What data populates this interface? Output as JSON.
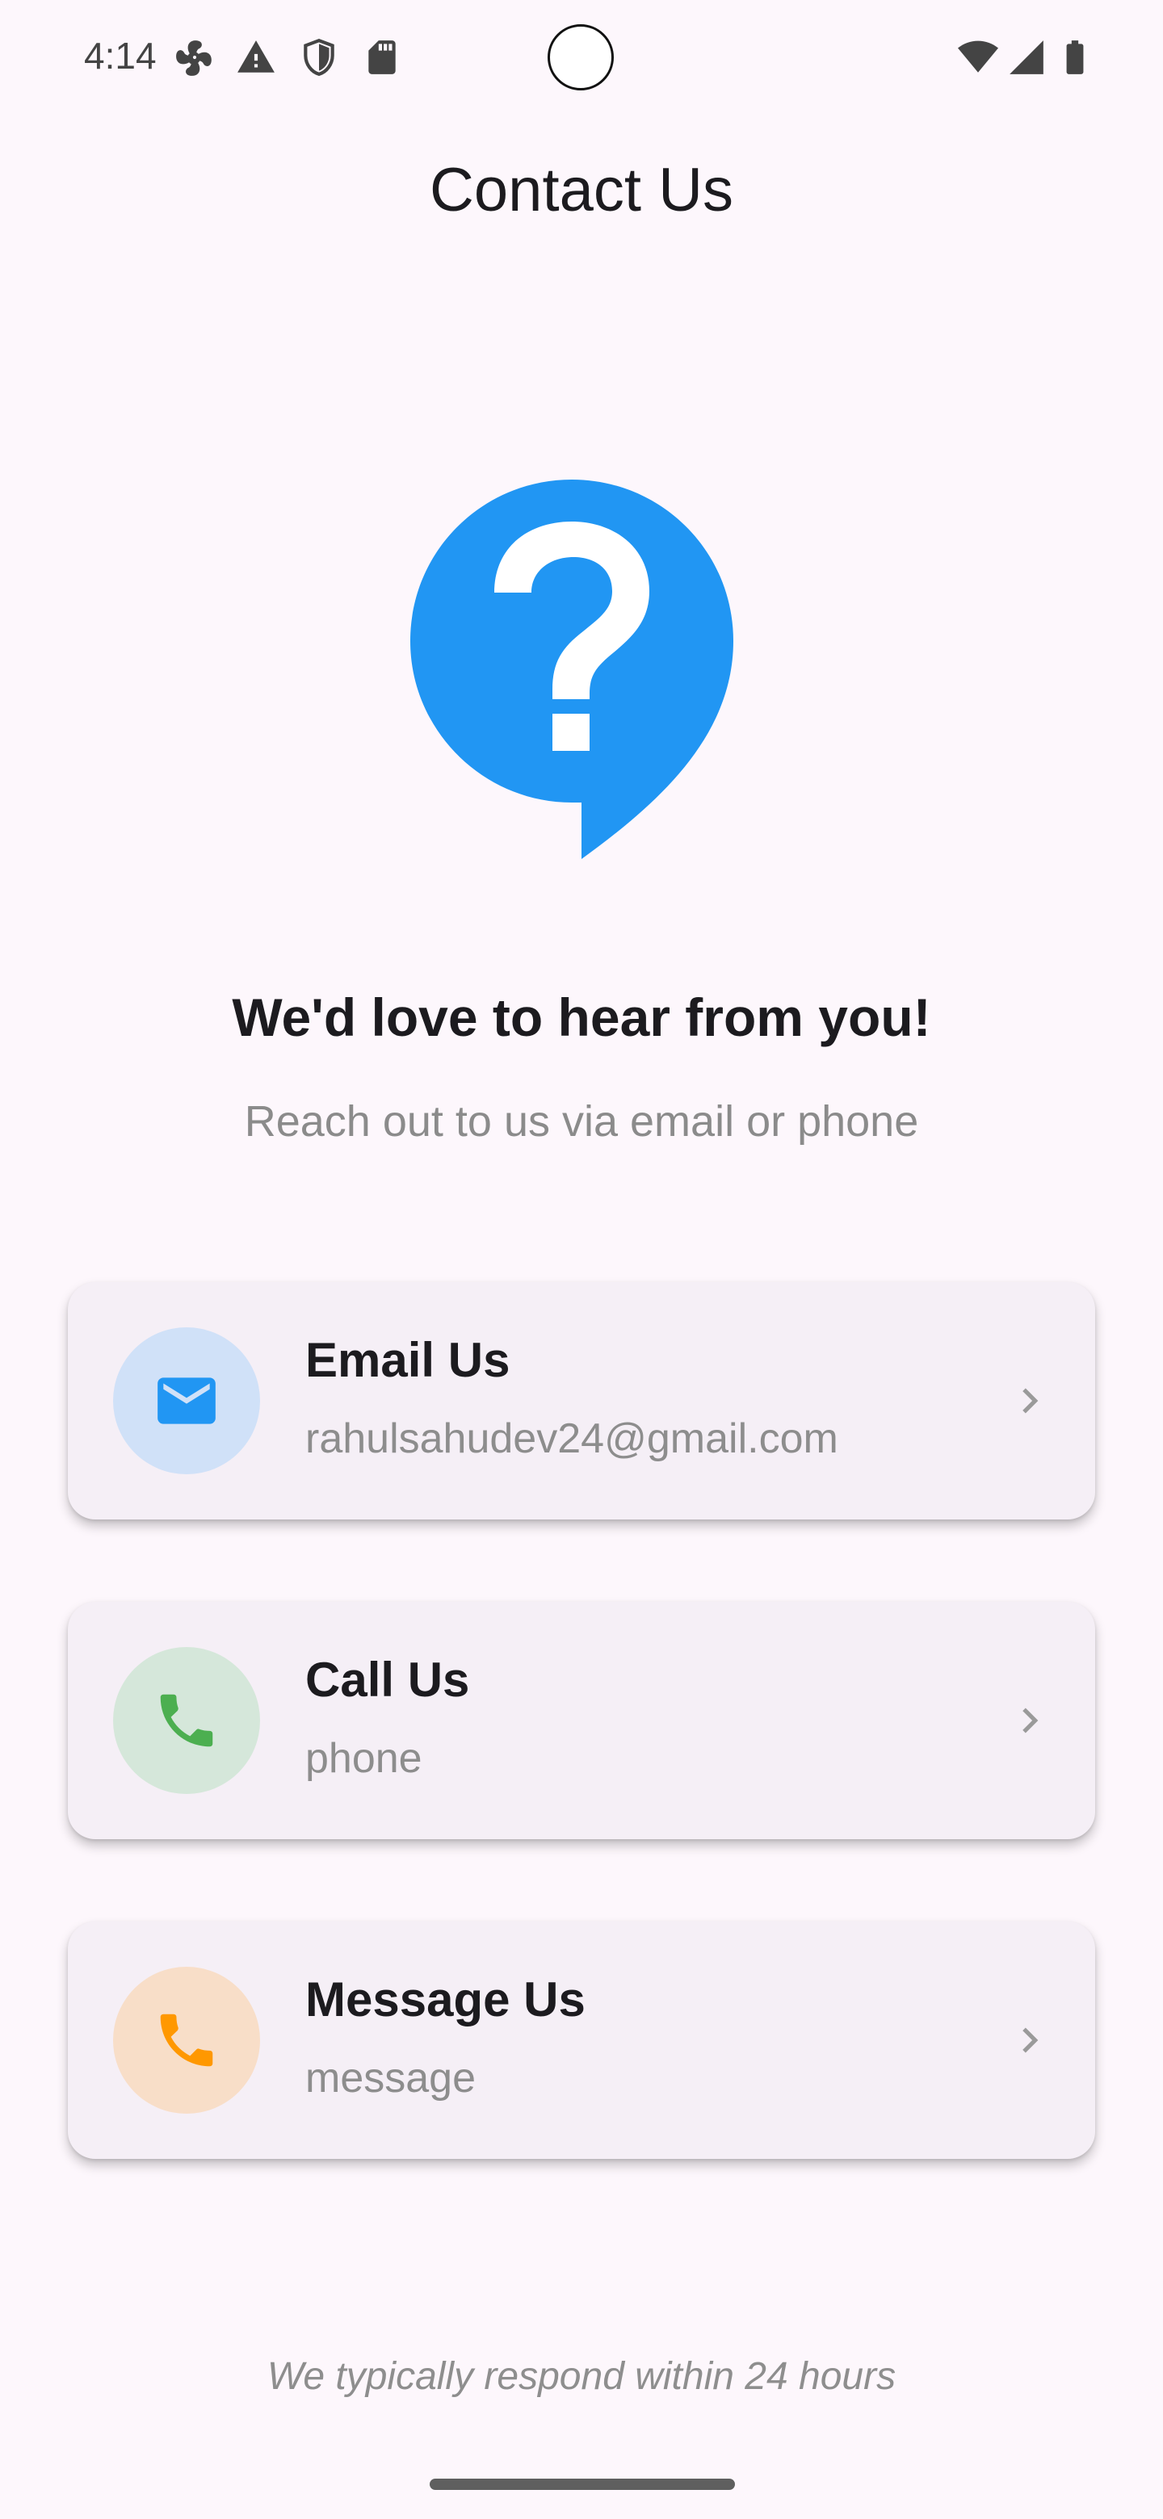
{
  "status_bar": {
    "time": "4:14",
    "left_icons": [
      "fan-icon",
      "alert-icon",
      "shield-icon",
      "sd-card-icon"
    ],
    "right_icons": [
      "wifi-icon",
      "signal-icon",
      "battery-icon"
    ]
  },
  "header": {
    "title": "Contact Us"
  },
  "hero": {
    "icon": "help-bubble-icon",
    "headline": "We'd love to hear from you!",
    "subheadline": "Reach out to us via email or phone"
  },
  "contact_options": [
    {
      "title": "Email Us",
      "subtitle": "rahulsahudev24@gmail.com",
      "icon": "mail-icon",
      "icon_color": "#2196f3",
      "circle_color": "#d0e1f8"
    },
    {
      "title": "Call Us",
      "subtitle": "phone",
      "icon": "phone-icon",
      "icon_color": "#4caf50",
      "circle_color": "#d5e7da"
    },
    {
      "title": "Message Us",
      "subtitle": "message",
      "icon": "phone-icon",
      "icon_color": "#ff9800",
      "circle_color": "#f8dec8"
    }
  ],
  "footer": {
    "note": "We typically respond within 24 hours"
  },
  "colors": {
    "background": "#fdf7fc",
    "card": "#f5eff6",
    "accent": "#2196f3"
  }
}
